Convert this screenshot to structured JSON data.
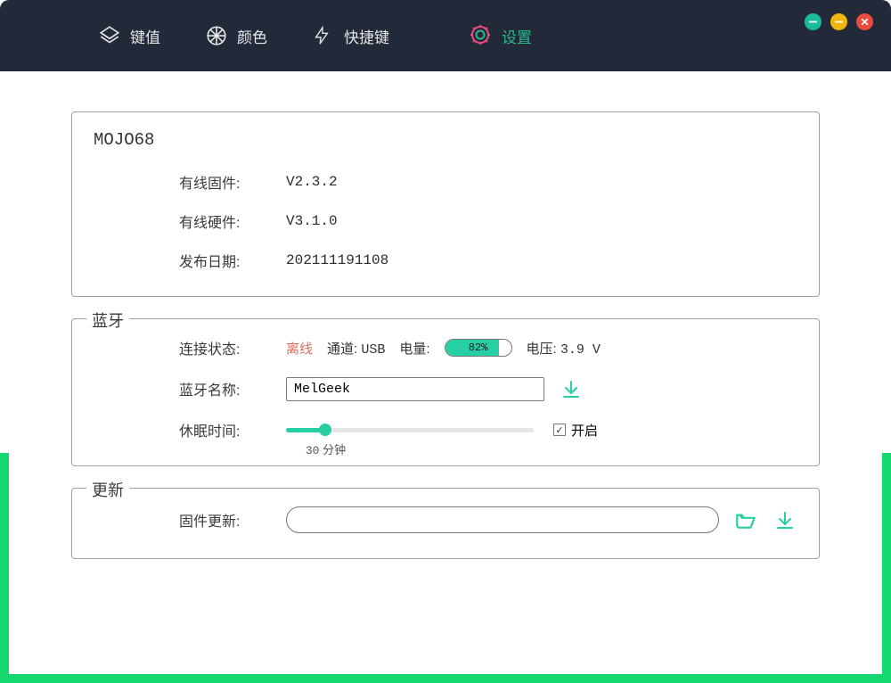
{
  "nav": {
    "keys": "键值",
    "color": "颜色",
    "shortcut": "快捷键",
    "settings": "设置"
  },
  "device": {
    "name": "MOJO68",
    "labels": {
      "firmware": "有线固件:",
      "hardware": "有线硬件:",
      "release_date": "发布日期:"
    },
    "firmware_version": "V2.3.2",
    "hardware_version": "V3.1.0",
    "release_date": "202111191108"
  },
  "bluetooth": {
    "legend": "蓝牙",
    "labels": {
      "conn_state": "连接状态:",
      "bt_name": "蓝牙名称:",
      "sleep_time": "休眠时间:"
    },
    "status_offline": "离线",
    "channel_label": "通道:",
    "channel_value": "USB",
    "battery_label": "电量:",
    "battery_percent": 82,
    "battery_text": "82%",
    "voltage_label": "电压:",
    "voltage_value": "3.9 V",
    "bt_name_value": "MelGeek",
    "sleep_minutes": 30,
    "sleep_unit": "分钟",
    "enable_label": "开启",
    "enable_checked": true
  },
  "update": {
    "legend": "更新",
    "label": "固件更新:",
    "path_value": ""
  },
  "colors": {
    "accent": "#27cfa5"
  }
}
